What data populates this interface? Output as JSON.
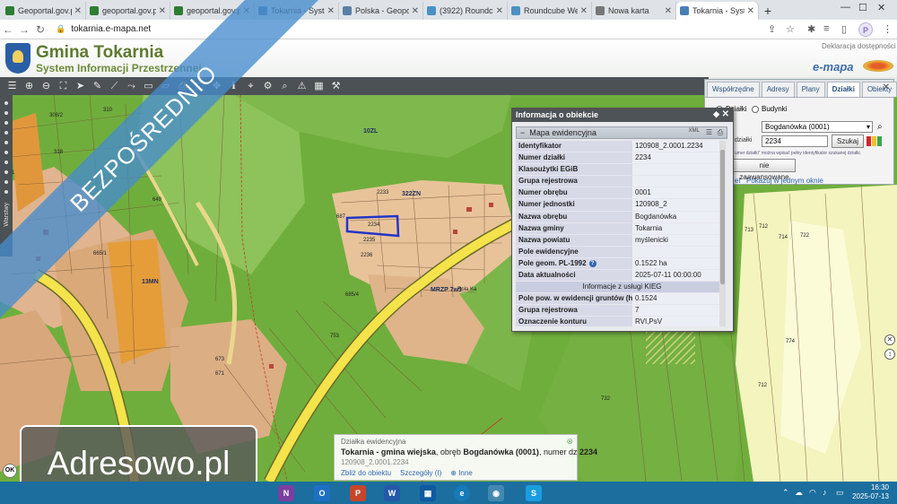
{
  "browser": {
    "tabs": [
      {
        "label": "Geoportal.gov.pl",
        "color": "#2e7d32"
      },
      {
        "label": "geoportal.gov.pl",
        "color": "#2e7d32"
      },
      {
        "label": "geoportal.gov.pl",
        "color": "#2e7d32"
      },
      {
        "label": "Tokarnia - Syste",
        "color": "#4a7fb5"
      },
      {
        "label": "Polska - Geopor",
        "color": "#5a7fa5"
      },
      {
        "label": "(3922) Roundcub",
        "color": "#4a90c2"
      },
      {
        "label": "Roundcube Web",
        "color": "#4a90c2"
      },
      {
        "label": "Nowa karta",
        "color": "#777777"
      },
      {
        "label": "Tokarnia - Syste",
        "color": "#4a7fb5"
      }
    ],
    "url": "tokarnia.e-mapa.net",
    "profile_initial": "P"
  },
  "site": {
    "title": "Gmina Tokarnia",
    "subtitle": "System Informacji Przestrzennej",
    "accessibility": "Deklaracja dostępności",
    "brand": "e-mapa"
  },
  "banner": "BEZPOŚREDNIO",
  "side_rail_label": "Warstwy",
  "search_panel": {
    "tabs": [
      "Współrzędne",
      "Adresy",
      "Plany",
      "Działki",
      "Obiekty"
    ],
    "active_tab": "Działki",
    "radio_dzialki": "Działki",
    "radio_budynki": "Budynki",
    "obreb": "Bogdanówka (0001)",
    "field_label": "działki",
    "parcel_value": "2234",
    "search_button": "Szukaj",
    "hint": "umer działki\" można wpisać pełny identyfikator szukanej działki.",
    "advanced_button": "nie zaawansowane",
    "link_1": "el",
    "link_2": "Pokazuj w jednym oknie"
  },
  "popup": {
    "title": "Informacja o obiekcie",
    "section": "Mapa ewidencyjna",
    "xml": "XML",
    "rows": [
      {
        "k": "Identyfikator",
        "v": "120908_2.0001.2234"
      },
      {
        "k": "Numer działki",
        "v": "2234"
      },
      {
        "k": "Klasoużytki EGiB",
        "v": ""
      },
      {
        "k": "Grupa rejestrowa",
        "v": ""
      },
      {
        "k": "Numer obrębu",
        "v": "0001"
      },
      {
        "k": "Numer jednostki",
        "v": "120908_2"
      },
      {
        "k": "Nazwa obrębu",
        "v": "Bogdanówka"
      },
      {
        "k": "Nazwa gminy",
        "v": "Tokarnia"
      },
      {
        "k": "Nazwa powiatu",
        "v": "myślenicki"
      },
      {
        "k": "Pole ewidencyjne",
        "v": ""
      },
      {
        "k": "Pole geom. PL-1992",
        "v": "0.1522 ha"
      },
      {
        "k": "Data aktualności",
        "v": "2025-07-11 00:00:00"
      }
    ],
    "subheader": "Informacje z usługi KIEG",
    "rows2": [
      {
        "k": "Pole pow. w ewidencji gruntów (ha)",
        "v": "0.1524"
      },
      {
        "k": "Grupa rejestrowa",
        "v": "7"
      },
      {
        "k": "Oznaczenie konturu",
        "v": "RVI,PsV"
      }
    ]
  },
  "bottom_info": {
    "heading": "Działka ewidencyjna",
    "line_bold1": "Tokarnia - gmina wiejska",
    "line_mid": ", obręb ",
    "line_bold2": "Bogdanówka (0001)",
    "line_tail": ", numer dz ",
    "line_bold3": "2234",
    "id": "120908_2.0001.2234",
    "links": [
      "Zbliż do obiektu",
      "Szczegóły (I)",
      "Inne"
    ]
  },
  "map_labels": [
    {
      "t": "2234"
    },
    {
      "t": "2233"
    },
    {
      "t": "2235"
    },
    {
      "t": "2236"
    },
    {
      "t": "687"
    },
    {
      "t": "10ZL"
    },
    {
      "t": "322ZN"
    },
    {
      "t": "MRZP 7w3"
    },
    {
      "t": "Rola Ka"
    },
    {
      "t": "13MN"
    },
    {
      "t": "665/1"
    },
    {
      "t": "685/4"
    },
    {
      "t": "673"
    },
    {
      "t": "671"
    },
    {
      "t": "753"
    },
    {
      "t": "732"
    },
    {
      "t": "774"
    },
    {
      "t": "713"
    },
    {
      "t": "712"
    },
    {
      "t": "722"
    },
    {
      "t": "714"
    },
    {
      "t": "712"
    },
    {
      "t": "308/2"
    },
    {
      "t": "310"
    },
    {
      "t": "649"
    },
    {
      "t": "8/1"
    },
    {
      "t": "318"
    }
  ],
  "watermark": "Adresowo.pl",
  "ok_button": "OK",
  "taskbar": {
    "time": "16:30",
    "date": "2025-07-13"
  }
}
